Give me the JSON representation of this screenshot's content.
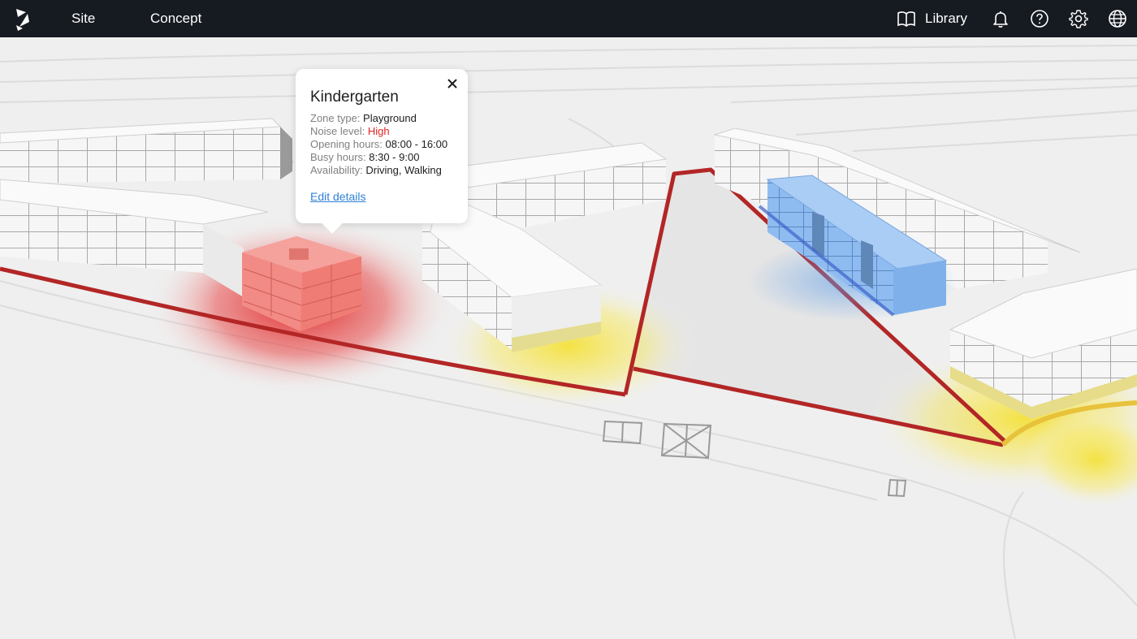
{
  "topbar": {
    "logo_icon": "brand-logo-icon",
    "nav": [
      {
        "label": "Site"
      },
      {
        "label": "Concept"
      }
    ],
    "library_label": "Library",
    "icons": [
      "book-icon",
      "bell-icon",
      "help-icon",
      "gear-icon",
      "globe-icon"
    ]
  },
  "popup": {
    "title": "Kindergarten",
    "rows": [
      {
        "label": "Zone type: ",
        "value": "Playground"
      },
      {
        "label": "Noise level: ",
        "value": "High"
      },
      {
        "label": "Opening hours: ",
        "value": "08:00 - 16:00"
      },
      {
        "label": "Busy hours: ",
        "value": "8:30 - 9:00"
      },
      {
        "label": "Availability: ",
        "value": "Driving, Walking"
      }
    ],
    "link_label": "Edit details"
  },
  "colors": {
    "topbar": "#161a21",
    "noise_high": "#e02323",
    "noise_medium": "#f4e13a",
    "selected_building": "#8fbcf0",
    "highlighted_building": "#f28b85",
    "road": "#b32626",
    "link": "#2f80d6"
  }
}
